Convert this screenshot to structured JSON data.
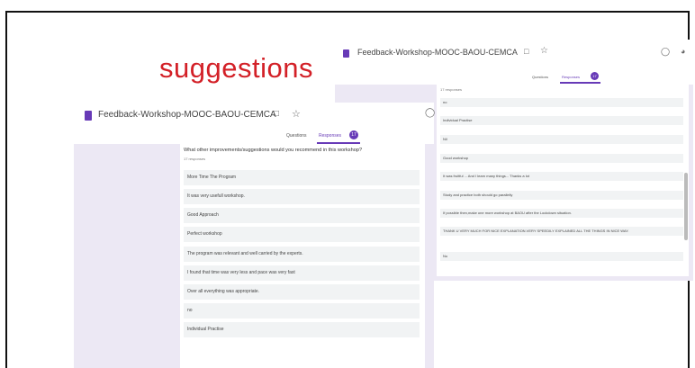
{
  "slide": {
    "title": "suggestions"
  },
  "right_screen": {
    "doc_title": "Feedback-Workshop-MOOC-BAOU-CEMCA",
    "tabs": {
      "questions": "Questions",
      "responses": "Responses",
      "badge": "17"
    },
    "response_count": "17 responses",
    "items": [
      "no",
      "Individual Practise",
      "Nil",
      "Good workshop",
      "It was fruitful ... And I learn many things... Thanks a lot",
      "Study and practice both should go parallelly",
      "If possible then,make one more workshop at BAOU after the Lockdown situation.",
      "THANK U VERY MUCH FOR NICE EXPLANATION.VERY SPEEDILY EXPLAINED ALL THE THINGS IN NICE WAY.",
      "No"
    ]
  },
  "left_screen": {
    "doc_title": "Feedback-Workshop-MOOC-BAOU-CEMCA",
    "tabs": {
      "questions": "Questions",
      "responses": "Responses",
      "badge": "17"
    },
    "question": "What other improvements/suggestions would you recommend in this workshop?",
    "response_count": "17 responses",
    "items": [
      "More Time The Program",
      "It was very usefull workshop.",
      "Good Approach",
      "Perfect workshop",
      "The program was relevant and well carried by the experts.",
      "I found that time was very less and pace was very fast",
      "Over all everything was appropriate.",
      "no",
      "Individual Practise"
    ]
  },
  "icons": {
    "form": "form-icon",
    "folder": "folder-icon",
    "star": "star-icon",
    "palette": "palette-icon",
    "preview": "eye-icon"
  },
  "colors": {
    "title": "#d32027",
    "accent": "#673ab7",
    "background_band": "#ece8f4",
    "item_bg": "#f1f3f4"
  }
}
